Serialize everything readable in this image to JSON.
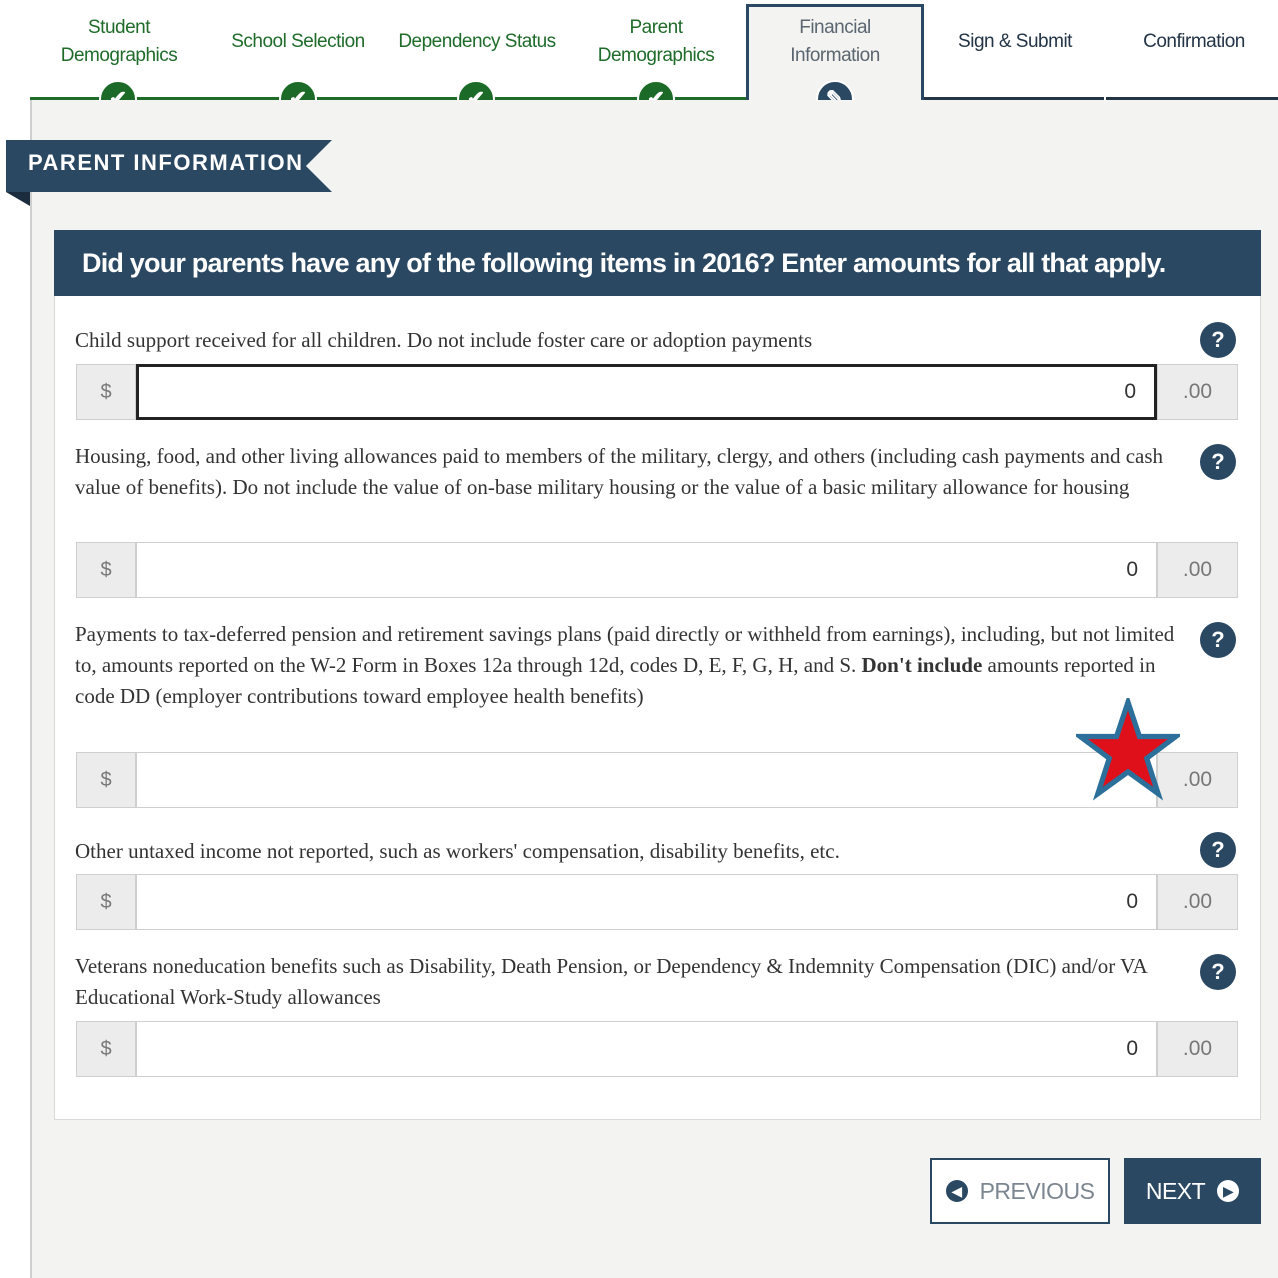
{
  "stepper": {
    "steps": [
      {
        "label": "Student Demographics",
        "status": "complete"
      },
      {
        "label": "School Selection",
        "status": "complete"
      },
      {
        "label": "Dependency Status",
        "status": "complete"
      },
      {
        "label": "Parent Demographics",
        "status": "complete"
      },
      {
        "label": "Financial Information",
        "status": "current"
      },
      {
        "label": "Sign & Submit",
        "status": "upcoming"
      },
      {
        "label": "Confirmation",
        "status": "upcoming"
      }
    ],
    "complete_icon": "✔",
    "current_icon": "✎"
  },
  "section": {
    "title": "PARENT INFORMATION"
  },
  "card": {
    "heading": "Did your parents have any of the following items in 2016? Enter amounts for all that apply."
  },
  "questions": [
    {
      "label": "Child support received for all children. Do not include foster care or adoption payments",
      "value": "0",
      "prefix": "$",
      "suffix": ".00"
    },
    {
      "label": "Housing, food, and other living allowances paid to members of the military, clergy, and others (including cash payments and cash value of benefits). Do not include the value of on-base military housing or the value of a basic military allowance for housing",
      "value": "0",
      "prefix": "$",
      "suffix": ".00"
    },
    {
      "label_pre": "Payments to tax-deferred pension and retirement savings plans (paid directly or withheld from earnings), including, but not limited to, amounts reported on the W-2 Form in Boxes 12a through 12d, codes D, E, F, G, H, and S.",
      "label_bold": "Don't include",
      "label_post": "amounts reported in code DD (employer contributions toward employee health benefits)",
      "value": "",
      "prefix": "$",
      "suffix": ".00"
    },
    {
      "label": "Other untaxed income not reported, such as workers' compensation, disability benefits, etc.",
      "value": "0",
      "prefix": "$",
      "suffix": ".00"
    },
    {
      "label": "Veterans noneducation benefits such as Disability, Death Pension, or Dependency & Indemnity Compensation (DIC) and/or VA Educational Work-Study allowances",
      "value": "0",
      "prefix": "$",
      "suffix": ".00"
    }
  ],
  "help_glyph": "?",
  "buttons": {
    "previous": "PREVIOUS",
    "next": "NEXT",
    "prev_icon": "◀",
    "next_icon": "▶"
  },
  "colors": {
    "brand_navy": "#2b4863",
    "complete_green": "#1c6a27",
    "star_red": "#e0101a"
  }
}
